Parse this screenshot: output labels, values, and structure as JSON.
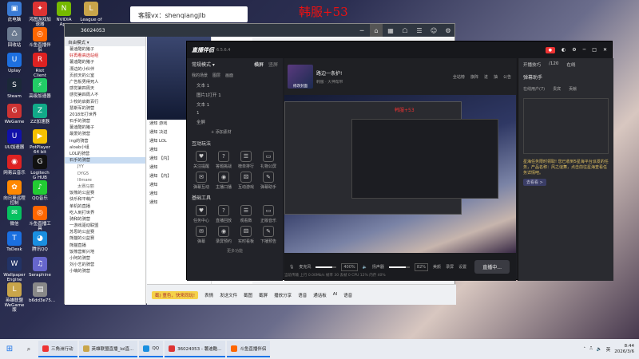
{
  "overlays": {
    "vx": "客服vx：shenqiangjlb",
    "han": "韩服+53"
  },
  "desktop": [
    {
      "label": "此电脑",
      "color": "#3a7bd5",
      "glyph": "▣"
    },
    {
      "label": "鸿图游戏加速器",
      "color": "#d33",
      "glyph": "✦"
    },
    {
      "label": "NVIDIA App",
      "color": "#76b900",
      "glyph": "N"
    },
    {
      "label": "League of Legends",
      "color": "#c9a54a",
      "glyph": "L"
    },
    {
      "label": "回收站",
      "color": "#6b7a90",
      "glyph": "♺"
    },
    {
      "label": "斗鱼直播伴侣",
      "color": "#f60",
      "glyph": "◎"
    },
    {
      "label": "Uplay",
      "color": "#1d6fe0",
      "glyph": "U"
    },
    {
      "label": "Riot Client",
      "color": "#d22",
      "glyph": "R"
    },
    {
      "label": "Steam",
      "color": "#1b2838",
      "glyph": "S"
    },
    {
      "label": "高级加速器",
      "color": "#2c6",
      "glyph": "⚡"
    },
    {
      "label": "WeGame",
      "color": "#c33",
      "glyph": "G"
    },
    {
      "label": "ZZ加速器",
      "color": "#1a8",
      "glyph": "Z"
    },
    {
      "label": "UU加速器",
      "color": "#11a",
      "glyph": "U"
    },
    {
      "label": "PotPlayer 64 bit",
      "color": "#f5c000",
      "glyph": "▶"
    },
    {
      "label": "网易云音乐",
      "color": "#d22",
      "glyph": "◉"
    },
    {
      "label": "Logitech G HUB",
      "color": "#111",
      "glyph": "G"
    },
    {
      "label": "向日葵远程控制",
      "color": "#f80",
      "glyph": "✿"
    },
    {
      "label": "QQ音乐",
      "color": "#2c3",
      "glyph": "♪"
    },
    {
      "label": "微信",
      "color": "#07c160",
      "glyph": "✉"
    },
    {
      "label": "斗鱼直播工具",
      "color": "#f60",
      "glyph": "◎"
    },
    {
      "label": "ToDesk",
      "color": "#1a6fe0",
      "glyph": "T"
    },
    {
      "label": "腾讯QQ",
      "color": "#1a8fe0",
      "glyph": "◕"
    },
    {
      "label": "Wallpaper Engine",
      "color": "#236",
      "glyph": "W"
    },
    {
      "label": "Seraphine",
      "color": "#66c",
      "glyph": "♫"
    },
    {
      "label": "英雄联盟 WeGame版",
      "color": "#c9a54a",
      "glyph": "L"
    },
    {
      "label": "b6dd3e75...",
      "color": "#888",
      "glyph": "▤"
    }
  ],
  "chat": {
    "title": "36024053",
    "group_header": "自由模式 ▾",
    "groups": [
      "薯迪酷的猪子",
      "好再看高选站组",
      "薯迪酷的猪子",
      "漂边的小伙伴",
      "页叔天的公室",
      "广告板男得死人",
      "感觉第四周天",
      "感觉第四周人不",
      "少校的启数百行",
      "慧斯军的骑营",
      "2018年打世界",
      "石手的骑营",
      "薯迪酷的猪子",
      "最爱的骑营",
      "ing的骑营",
      "aloab小组",
      "LOL的骑营",
      "石手的骑营",
      "JYY",
      "DYG5",
      "Illmare",
      "太赛马丽",
      "饭熊的公益赛",
      "快乐和平萌广",
      "单机的直播",
      "吃人到打世界",
      "骑和的骑营",
      "一游戏驱动联盟",
      "苏思的公益赛",
      "熊猫的公益赛",
      "熊猫直播",
      "饭熊营新兴地",
      "小阿的骑营",
      "刘小艺的骑营",
      "小萌的骑营"
    ],
    "mid_items": [
      "通知 游戏",
      "通知 决进",
      "通知 LOL",
      "通知",
      "通知 【内】",
      "通知",
      "通知 【内】",
      "通知",
      "通知",
      "通知"
    ],
    "bottom": [
      "表情",
      "发送文件",
      "截图",
      "截屏",
      "播放分享",
      "语音",
      "通话板",
      "AI",
      "语音"
    ],
    "pill": "截) 童色，快来同玩!"
  },
  "live": {
    "app": "直播伴侣",
    "version": "6.5.6.4",
    "mode": "常规模式 ▾",
    "mode_tabs": [
      "横屏",
      "竖屏"
    ],
    "scene_tabs": [
      "我的场景",
      "图层",
      "画面"
    ],
    "scenes": [
      "文本 1",
      "图片1打开 1",
      "文本 1",
      "1",
      "全屏"
    ],
    "add_source": "+ 添加素材",
    "sec_interact": "互动玩法",
    "interact_tools": [
      "关注提醒",
      "答题挑战",
      "榜单排行",
      "礼物公屏",
      "弹幕互动",
      "主播口播",
      "互动游戏",
      "弹幕助手"
    ],
    "sec_tools": "基础工具",
    "basic_tools": [
      "任务中心",
      "直播回放",
      "观看数",
      "正版音乐",
      "弹幕",
      "录屏预约",
      "实时看板",
      "下播预告"
    ],
    "more": "更多功能",
    "room_title": "路边一条护!",
    "room_sub": "韩服 · 大神帮带",
    "cover": "修改封面",
    "stage_icons": [
      "全站榜",
      "旗阵",
      "进",
      "抽",
      "公告"
    ],
    "mic": "麦克风",
    "mic_pct": "400%",
    "speaker": "扬声器",
    "spk_pct": "82%",
    "ctrl": [
      "美颜",
      "录屏",
      "设置"
    ],
    "golive": "直播中...",
    "status": "当前传输  上行 0.00Mb/s  帧率 30  丢帧 0  CPU 12%  内存 40%",
    "right_head": [
      "开播技巧",
      "/120",
      "在线"
    ],
    "assistant": "弹幕助手",
    "assistant_tabs": [
      "在线用户(7)",
      "贵宾",
      "贡献"
    ],
    "promo": "星海任务限时领取! 您已收到5星海平台派发的任务，产品名称：风之谜舞，点击前往星海查看任务详情吧。",
    "more_btn": "去看看 >"
  },
  "taskbar": {
    "items": [
      {
        "label": "三角洲行动",
        "color": "#e33"
      },
      {
        "label": "英雄联盟直播_lol直...",
        "color": "#c9a54a"
      },
      {
        "label": "QQ",
        "color": "#1a8fe0"
      },
      {
        "label": "36024053 - 薯迪酷...",
        "color": "#d33"
      },
      {
        "label": "斗鱼直播伴侣",
        "color": "#f60"
      }
    ],
    "ime": "英",
    "time": "8:44",
    "date": "2026/3/6"
  }
}
